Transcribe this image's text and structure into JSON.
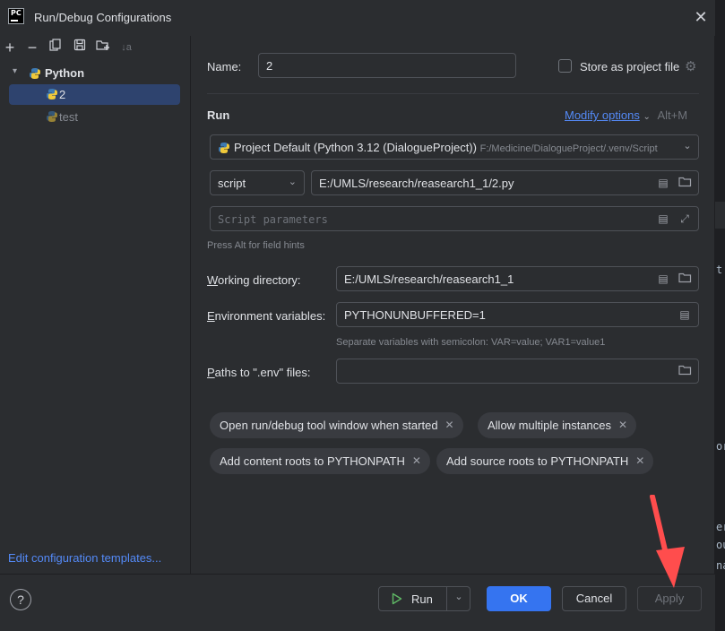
{
  "window": {
    "app_icon_text": "PC",
    "title": "Run/Debug Configurations",
    "close_glyph": "✕"
  },
  "toolbar": {
    "add": "+",
    "remove": "−",
    "copy": "⧉",
    "save": "💾",
    "new_folder": "📁",
    "sort": "↓a"
  },
  "tree": {
    "group_label": "Python",
    "items": [
      {
        "label": "2",
        "selected": true
      },
      {
        "label": "test",
        "selected": false
      }
    ],
    "edit_templates": "Edit configuration templates..."
  },
  "form": {
    "name_label": "Name:",
    "name_value": "2",
    "store_label": "Store as project file",
    "store_checked": false,
    "run_section": "Run",
    "modify_options": "Modify options",
    "modify_shortcut": "Alt+M",
    "interpreter": {
      "name": "Project Default (Python 3.12 (DialogueProject))",
      "path": "F:/Medicine/DialogueProject/.venv/Script"
    },
    "script_type": "script",
    "script_path": "E:/UMLS/research/reasearch1_1/2.py",
    "script_params_placeholder": "Script parameters",
    "alt_hint": "Press Alt for field hints",
    "workdir_label": "Working directory:",
    "workdir_value": "E:/UMLS/research/reasearch1_1",
    "env_label": "Environment variables:",
    "env_value": "PYTHONUNBUFFERED=1",
    "env_hint": "Separate variables with semicolon: VAR=value; VAR1=value1",
    "dotenv_label": "Paths to \".env\" files:",
    "dotenv_value": ""
  },
  "chips": [
    "Open run/debug tool window when started",
    "Allow multiple instances",
    "Add content roots to PYTHONPATH",
    "Add source roots to PYTHONPATH"
  ],
  "buttons": {
    "help": "?",
    "run": "Run",
    "ok": "OK",
    "cancel": "Cancel",
    "apply": "Apply"
  },
  "background_editor": {
    "fragments": [
      "t",
      "or",
      "er",
      "ou",
      "na"
    ]
  },
  "colors": {
    "accent": "#3574f0",
    "link": "#548af7",
    "arrow": "#ff4d4d"
  }
}
